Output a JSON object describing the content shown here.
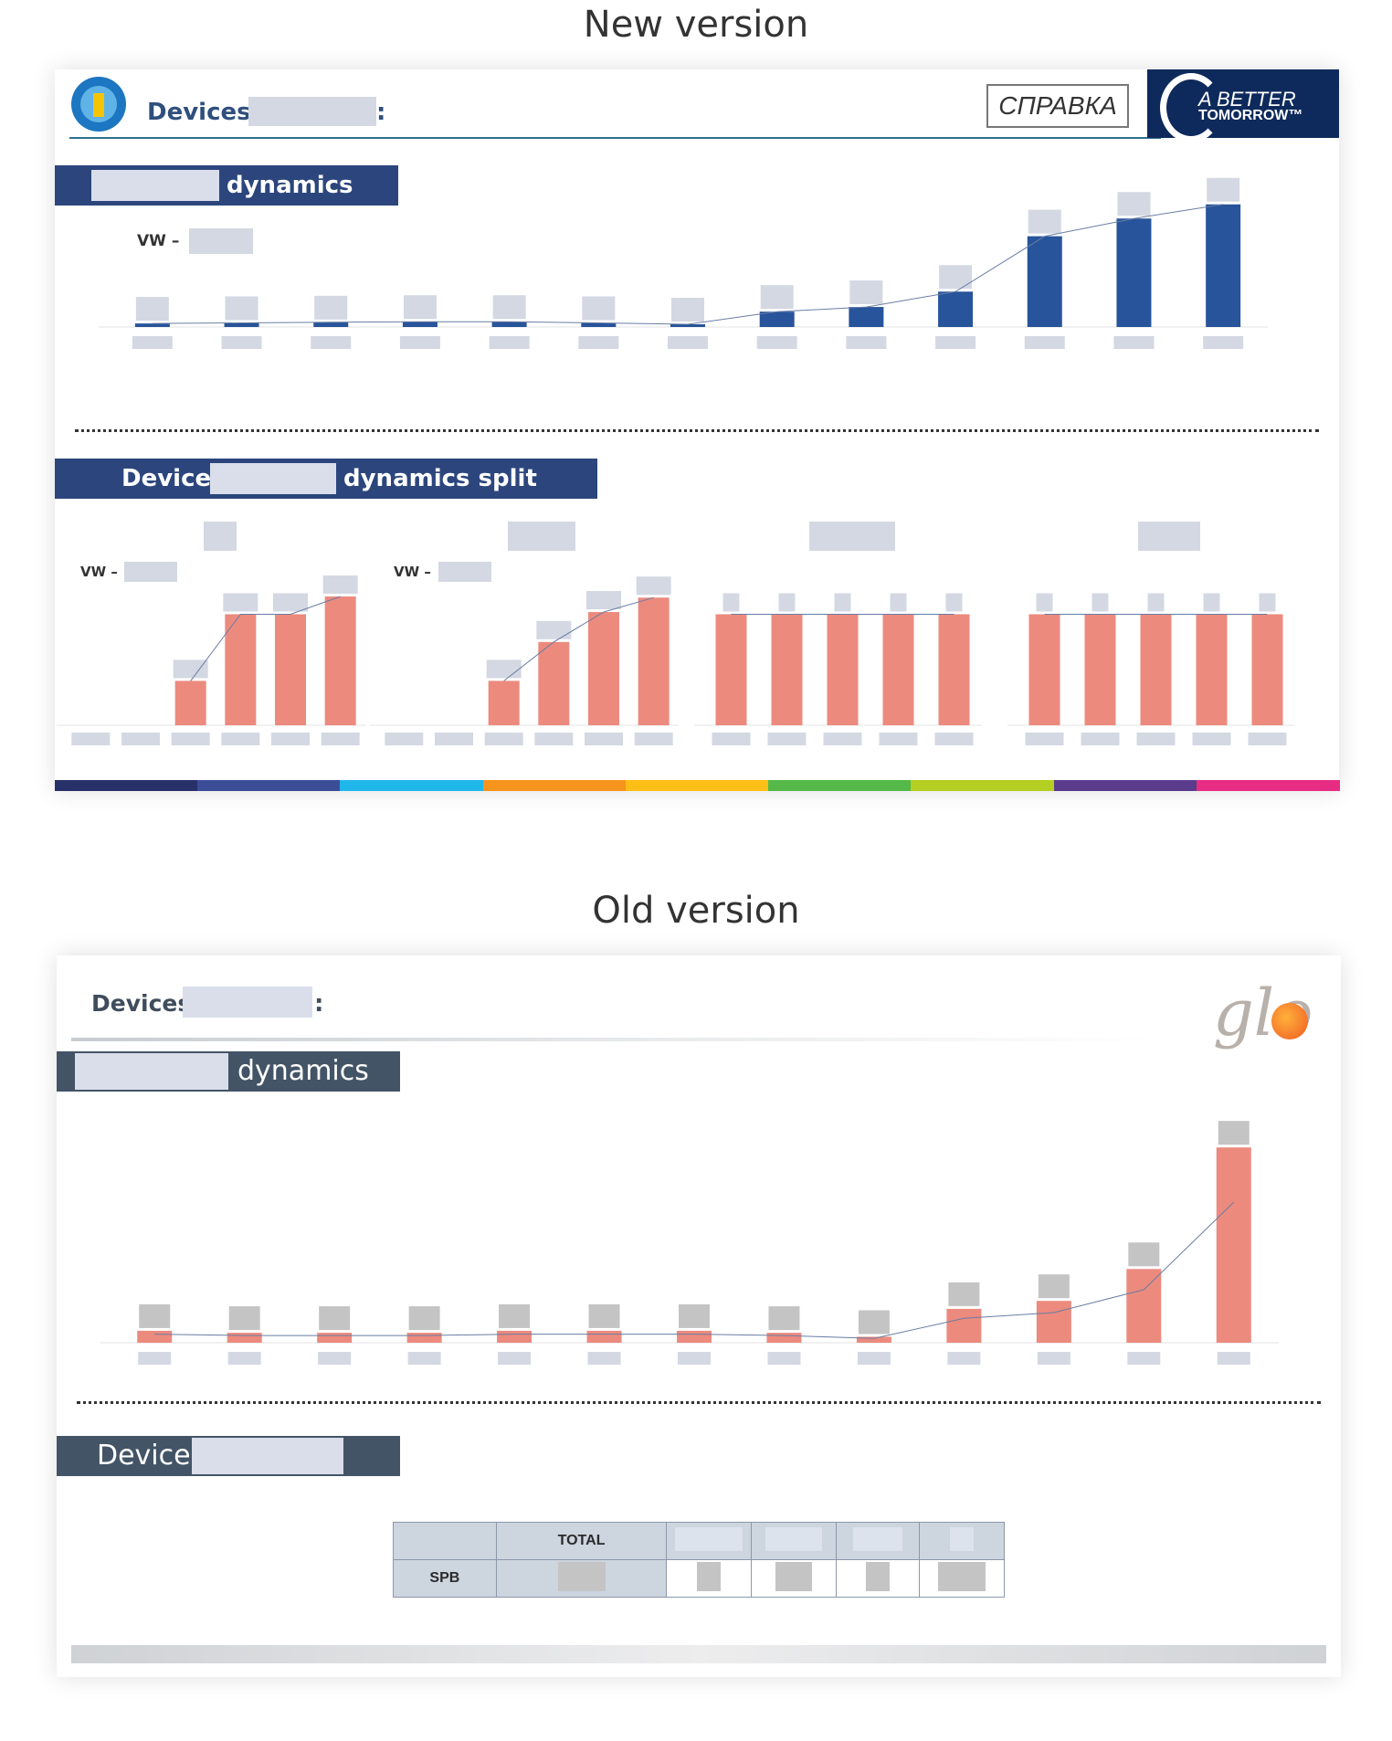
{
  "titles": {
    "new": "New version",
    "old": "Old version"
  },
  "new_slide": {
    "header_label": "Devices",
    "header_colon": ":",
    "ref_button": "СПРАВКА",
    "brand_line1": "A BETTER",
    "brand_line2": "TOMORROW™",
    "section1_label": "dynamics",
    "vw_prefix": "VW –",
    "section2_word": "Device",
    "section2_suffix": "dynamics split",
    "small_vw_prefix": "VW –",
    "colors": {
      "bar": "#27549a",
      "split_bar": "#ec8a7e",
      "navy": "#2c467d"
    },
    "stripe_colors": [
      "#28306a",
      "#3b4d97",
      "#1fb7ea",
      "#f7941d",
      "#fdbf16",
      "#54b948",
      "#b4cf21",
      "#5b3c8c",
      "#e72c84"
    ]
  },
  "old_slide": {
    "header_label": "Devices",
    "header_colon": ":",
    "logo_text": "glo",
    "section1_label": "dynamics",
    "section2_word": "Device",
    "table": {
      "total_header": "TOTAL",
      "row_label": "SPB"
    },
    "colors": {
      "bar": "#ec8a7e",
      "slate": "#435466"
    }
  },
  "chart_data": [
    {
      "type": "bar",
      "values": [
        3,
        3.5,
        4,
        4.5,
        4.5,
        3.5,
        2,
        13,
        17,
        30,
        77,
        92,
        104
      ],
      "ylim": [
        0,
        110
      ]
    },
    {
      "type": "bar",
      "values": [
        0,
        0,
        40,
        100,
        100,
        116
      ],
      "ylim": [
        0,
        130
      ]
    },
    {
      "type": "bar",
      "values": [
        0,
        0,
        40,
        75,
        102,
        115
      ],
      "ylim": [
        0,
        130
      ]
    },
    {
      "type": "bar",
      "values": [
        100,
        100,
        100,
        100,
        100
      ],
      "ylim": [
        0,
        130
      ]
    },
    {
      "type": "bar",
      "values": [
        100,
        100,
        100,
        100,
        100
      ],
      "ylim": [
        0,
        130
      ]
    },
    {
      "type": "bar",
      "values": [
        6,
        5,
        5,
        5,
        6,
        6,
        6,
        5,
        3,
        17,
        21,
        37,
        98
      ],
      "ylim": [
        0,
        110
      ]
    }
  ]
}
